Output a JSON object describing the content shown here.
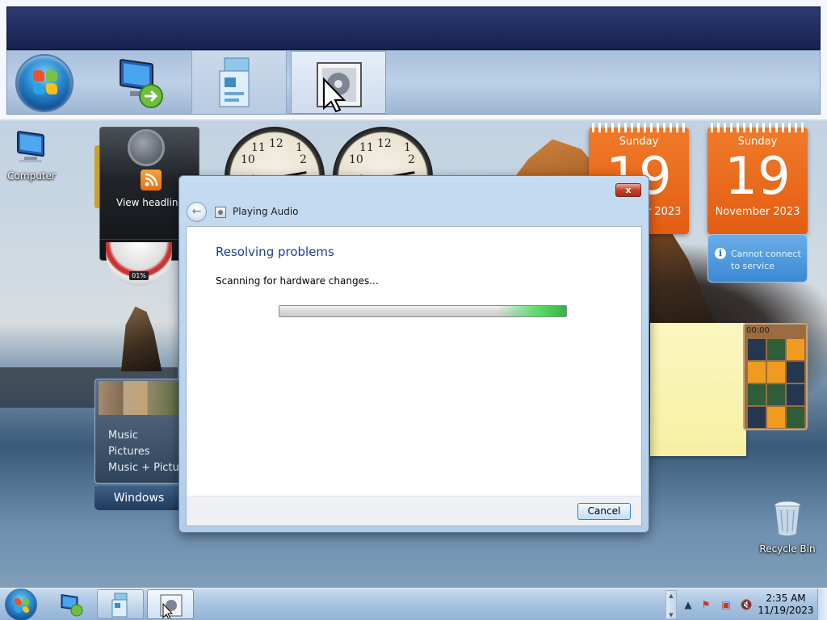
{
  "desktop": {
    "icons": {
      "computer": "Computer",
      "recycle_bin": "Recycle Bin"
    }
  },
  "gadgets": {
    "feed_label": "View headlines",
    "cpu_percent": "01%",
    "calendar": [
      {
        "day_of_week": "Sunday",
        "day": "19",
        "month_year": "November 2023"
      },
      {
        "day_of_week": "Sunday",
        "day": "19",
        "month_year": "November 2023"
      }
    ],
    "weather_message": "Cannot connect to service",
    "media_items": [
      "Music",
      "Pictures",
      "Music + Pictures"
    ],
    "media_brand": "Windows",
    "puzzle_time": "00:00"
  },
  "dialog": {
    "title": "Playing Audio",
    "close_label": "x",
    "heading": "Resolving problems",
    "status": "Scanning for hardware changes...",
    "progress_state": "indeterminate",
    "cancel_label": "Cancel"
  },
  "taskbar": {
    "time": "2:35 AM",
    "date": "11/19/2023",
    "tray_icons": [
      "action-center-error-icon",
      "network-error-icon",
      "volume-muted-icon"
    ]
  },
  "thumbnails": {
    "items": [
      "start-orb",
      "remote-desktop",
      "control-panel",
      "playing-audio"
    ]
  },
  "colors": {
    "calendar_orange": "#e35d12",
    "dialog_heading": "#1e3f8a",
    "progress_green": "#2fb540",
    "taskbar_blue": "#a8c3e0"
  }
}
